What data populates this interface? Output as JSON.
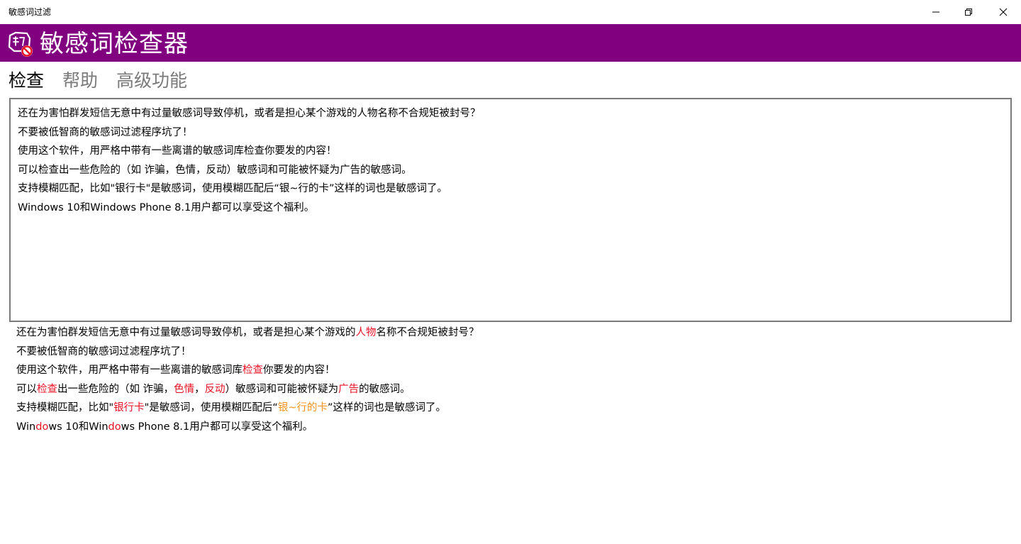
{
  "window": {
    "title": "敏感词过滤",
    "buttons": {
      "minimize": "minimize-icon",
      "restore": "restore-icon",
      "close": "close-icon"
    }
  },
  "header": {
    "title": "敏感词检查器",
    "background": "#800080",
    "logo_icon": "sensitive-word-logo-icon"
  },
  "tabs": [
    {
      "label": "检查",
      "active": true
    },
    {
      "label": "帮助",
      "active": false
    },
    {
      "label": "高级功能",
      "active": false
    }
  ],
  "input": {
    "value": "还在为害怕群发短信无意中有过量敏感词导致停机，或者是担心某个游戏的人物名称不合规矩被封号？\n不要被低智商的敏感词过滤程序坑了！\n使用这个软件，用严格中带有一些离谱的敏感词库检查你要发的内容！\n可以检查出一些危险的（如 诈骗，色情，反动）敏感词和可能被怀疑为广告的敏感词。\n支持模糊匹配，比如\"银行卡\"是敏感词，使用模糊匹配后“银~行的卡”这样的词也是敏感词了。\nWindows 10和Windows Phone 8.1用户都可以享受这个福利。"
  },
  "colors": {
    "exact_hit": "#e81123",
    "fuzzy_hit": "#f7931e"
  },
  "result": {
    "lines": [
      [
        {
          "text": "还在为害怕群发短信无意中有过量敏感词导致停机，或者是担心某个游戏的",
          "hl": ""
        },
        {
          "text": "人物",
          "hl": "red"
        },
        {
          "text": "名称不合规矩被封号？",
          "hl": ""
        }
      ],
      [
        {
          "text": "不要被低智商的敏感词过滤程序坑了！",
          "hl": ""
        }
      ],
      [
        {
          "text": "使用这个软件，用严格中带有一些离谱的敏感词库",
          "hl": ""
        },
        {
          "text": "检查",
          "hl": "red"
        },
        {
          "text": "你要发的内容！",
          "hl": ""
        }
      ],
      [
        {
          "text": "可以",
          "hl": ""
        },
        {
          "text": "检查",
          "hl": "red"
        },
        {
          "text": "出一些危险的（如 诈骗，",
          "hl": ""
        },
        {
          "text": "色情",
          "hl": "red"
        },
        {
          "text": "，",
          "hl": ""
        },
        {
          "text": "反动",
          "hl": "red"
        },
        {
          "text": "）敏感词和可能被怀疑为",
          "hl": ""
        },
        {
          "text": "广告",
          "hl": "red"
        },
        {
          "text": "的敏感词。",
          "hl": ""
        }
      ],
      [
        {
          "text": "支持模糊匹配，比如\"",
          "hl": ""
        },
        {
          "text": "银行卡",
          "hl": "red"
        },
        {
          "text": "\"是敏感词，使用模糊匹配后“",
          "hl": ""
        },
        {
          "text": "银~行的卡",
          "hl": "orange"
        },
        {
          "text": "”这样的词也是敏感词了。",
          "hl": ""
        }
      ],
      [
        {
          "text": "Win",
          "hl": ""
        },
        {
          "text": "do",
          "hl": "red"
        },
        {
          "text": "ws 10和Win",
          "hl": ""
        },
        {
          "text": "do",
          "hl": "red"
        },
        {
          "text": "ws Phone 8.1用户都可以享受这个福利。",
          "hl": ""
        }
      ]
    ]
  }
}
